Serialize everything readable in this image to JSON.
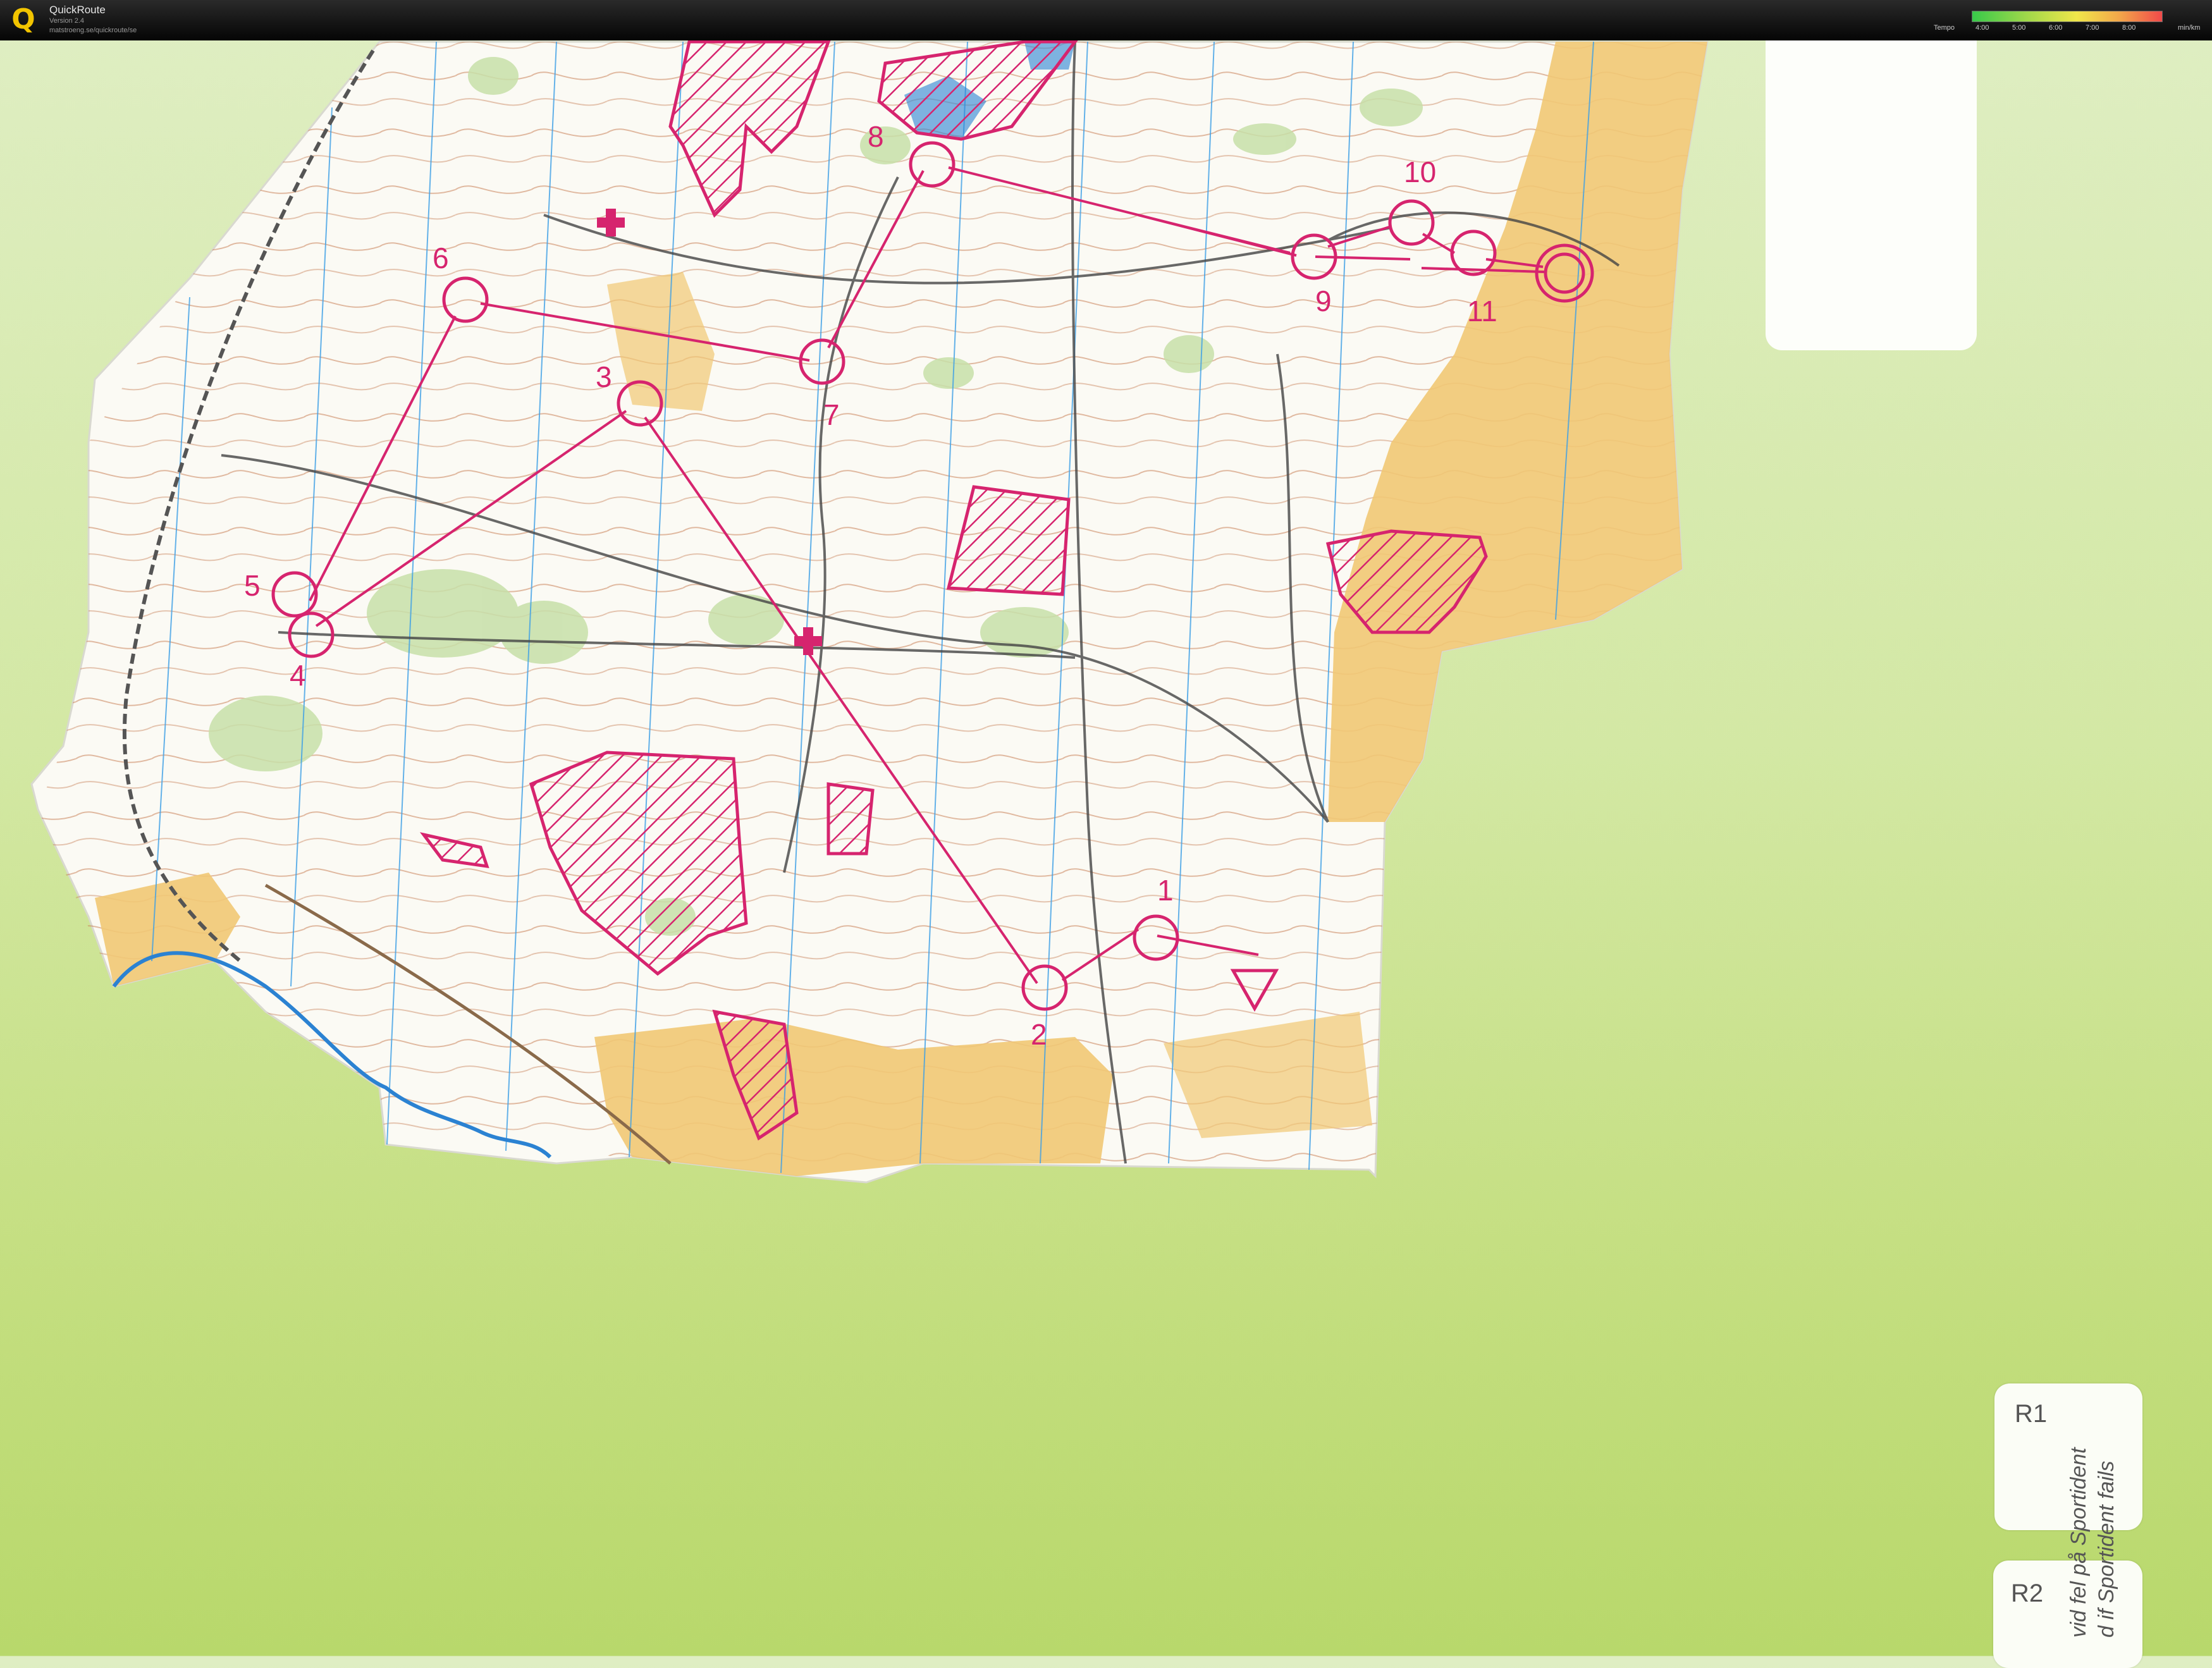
{
  "header": {
    "app_title": "QuickRoute",
    "version": "Version 2.4",
    "url": "matstroeng.se/quickroute/se",
    "logo_letter": "Q",
    "tempo_label": "Tempo",
    "tempo_ticks": [
      "4:00",
      "5:00",
      "6:00",
      "7:00",
      "8:00"
    ],
    "tempo_unit": "min/km"
  },
  "course": {
    "color": "#d6246e",
    "controls": [
      "1",
      "2",
      "3",
      "4",
      "5",
      "6",
      "7",
      "8",
      "9",
      "10",
      "11"
    ]
  },
  "cards": {
    "r1": "R1",
    "r2": "R2",
    "fail_text_se": "vid fel på Sportident",
    "fail_text_en": "d if Sportident fails"
  },
  "colors": {
    "map_paper": "#fbfaf4",
    "open_land": "#f1c874",
    "green": "#c7dfa8",
    "water": "#2b82d2",
    "background_green": "#cfe69a"
  }
}
